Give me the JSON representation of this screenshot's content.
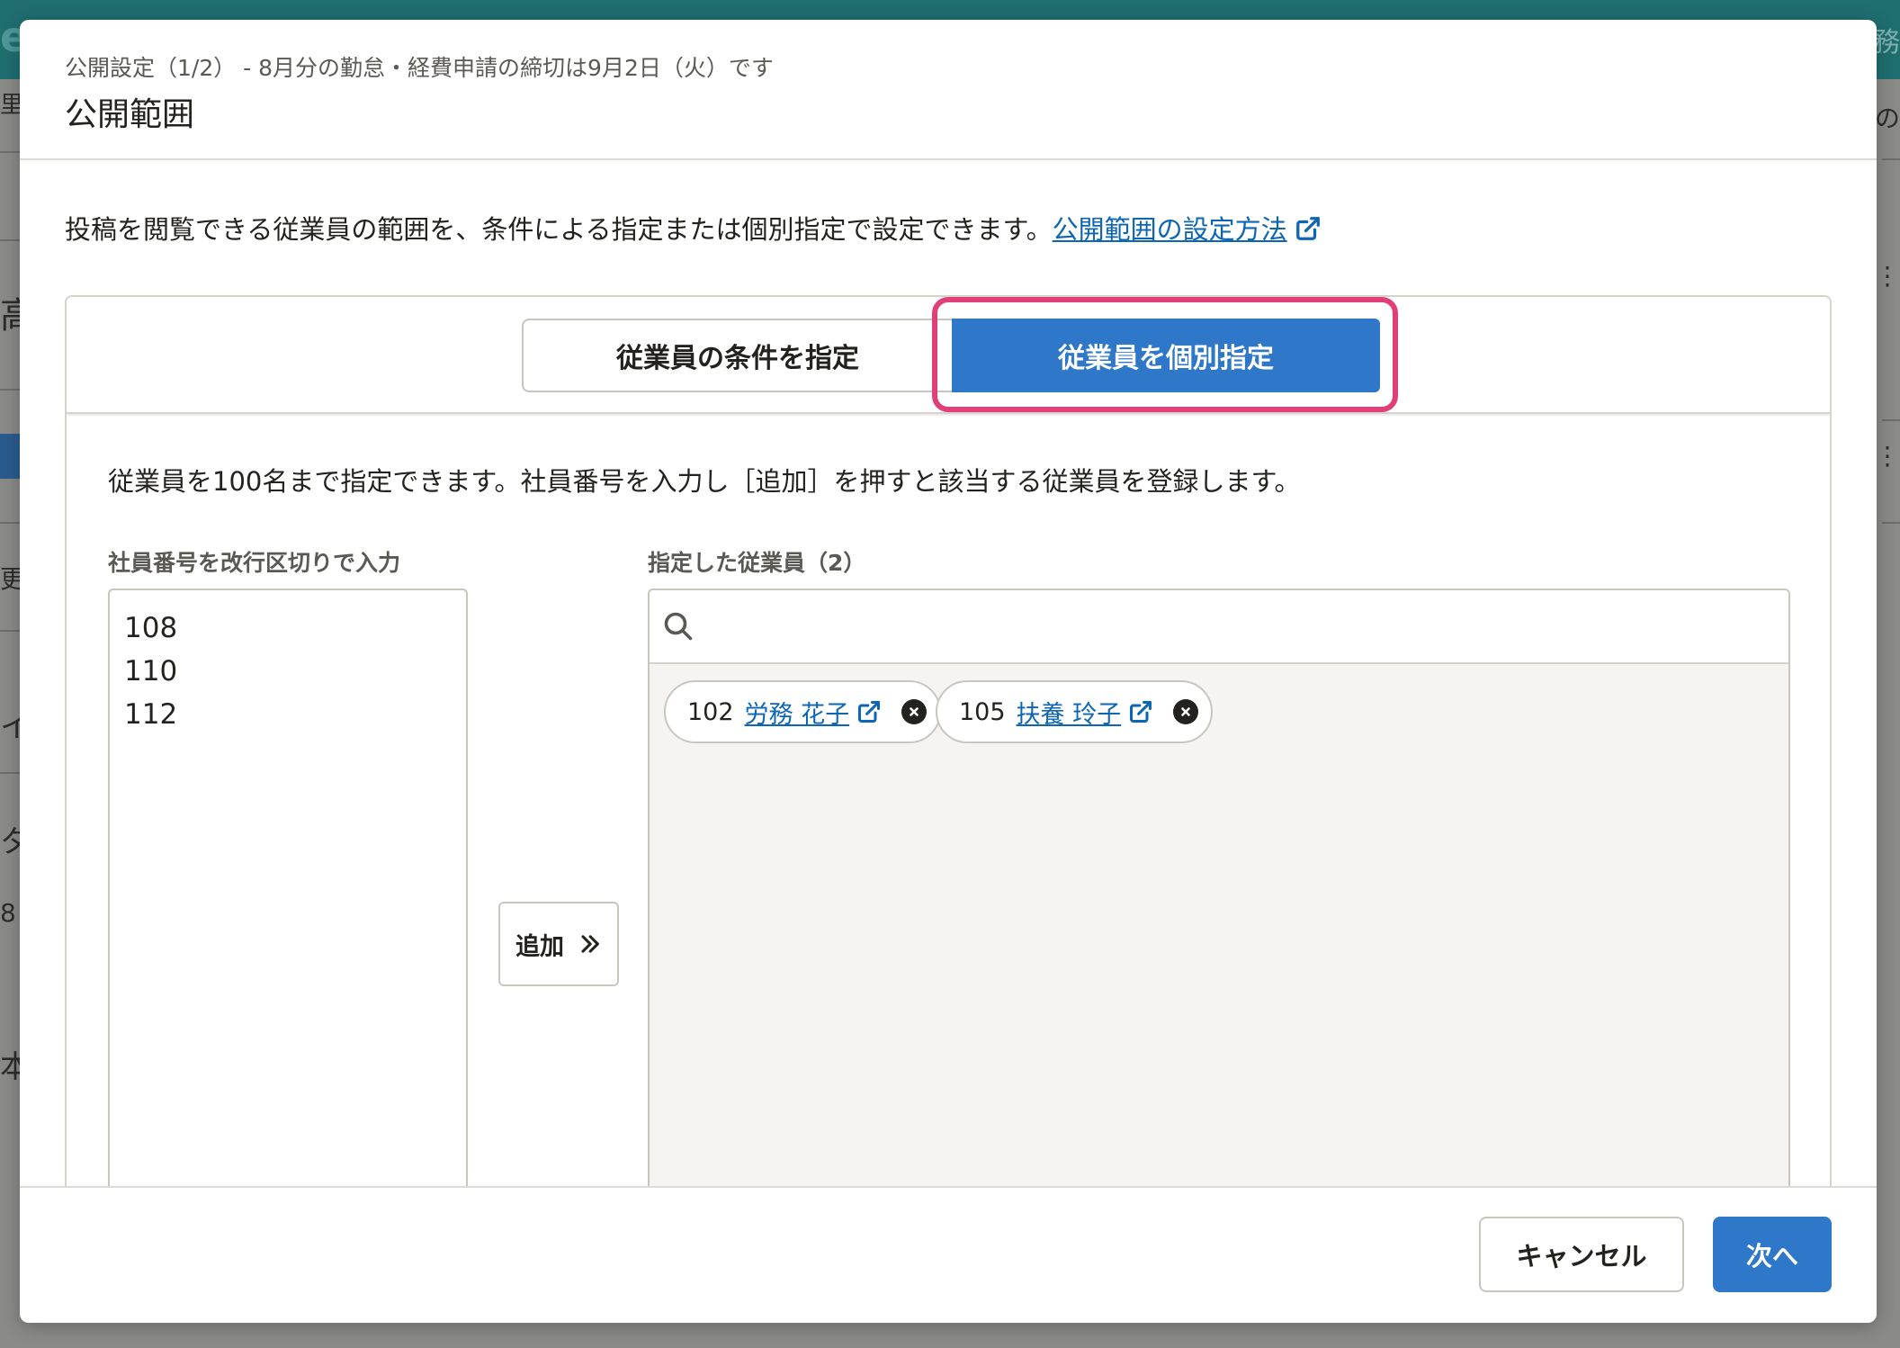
{
  "background": {
    "logo": "eH",
    "top_right": "務",
    "side_chars": [
      "里",
      "高",
      "更",
      "イ",
      "タ",
      "8",
      "本"
    ],
    "right_chars": [
      "の",
      "⋮",
      "⋮"
    ]
  },
  "modal": {
    "subtitle": "公開設定（1/2） - 8月分の勤怠・経費申請の締切は9月2日（火）です",
    "title": "公開範囲",
    "description": "投稿を閲覧できる従業員の範囲を、条件による指定または個別指定で設定できます。",
    "help_link": "公開範囲の設定方法",
    "tabs": [
      {
        "label": "従業員の条件を指定",
        "selected": false
      },
      {
        "label": "従業員を個別指定",
        "selected": true
      }
    ],
    "hint": "従業員を100名まで指定できます。社員番号を入力し［追加］を押すと該当する従業員を登録します。",
    "input_label": "社員番号を改行区切りで入力",
    "input_value": "108\n110\n112",
    "add_button": "追加",
    "selected_label": "指定した従業員（2）",
    "search_placeholder": "",
    "selected_employees": [
      {
        "number": "102",
        "name": "労務 花子"
      },
      {
        "number": "105",
        "name": "扶養 玲子"
      }
    ],
    "cancel_button": "キャンセル",
    "next_button": "次へ"
  },
  "colors": {
    "primary": "#2f77c8",
    "highlight": "#e13f78",
    "link": "#0d66b3"
  }
}
